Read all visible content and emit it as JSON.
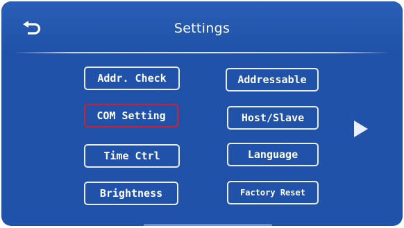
{
  "header": {
    "title": "Settings",
    "back_icon": "back-arrow-icon"
  },
  "buttons": {
    "addr_check": "Addr. Check",
    "addressable": "Addressable",
    "com_setting": "COM Setting",
    "host_slave": "Host/Slave",
    "time_ctrl": "Time Ctrl",
    "language": "Language",
    "brightness": "Brightness",
    "factory_reset": "Factory Reset"
  },
  "selected": "COM Setting",
  "next_icon": "next-page-arrow-icon",
  "colors": {
    "background": "#1f52a8",
    "button_border": "#e9eef8",
    "selected_border": "#d41f2d",
    "text": "#ffffff"
  }
}
